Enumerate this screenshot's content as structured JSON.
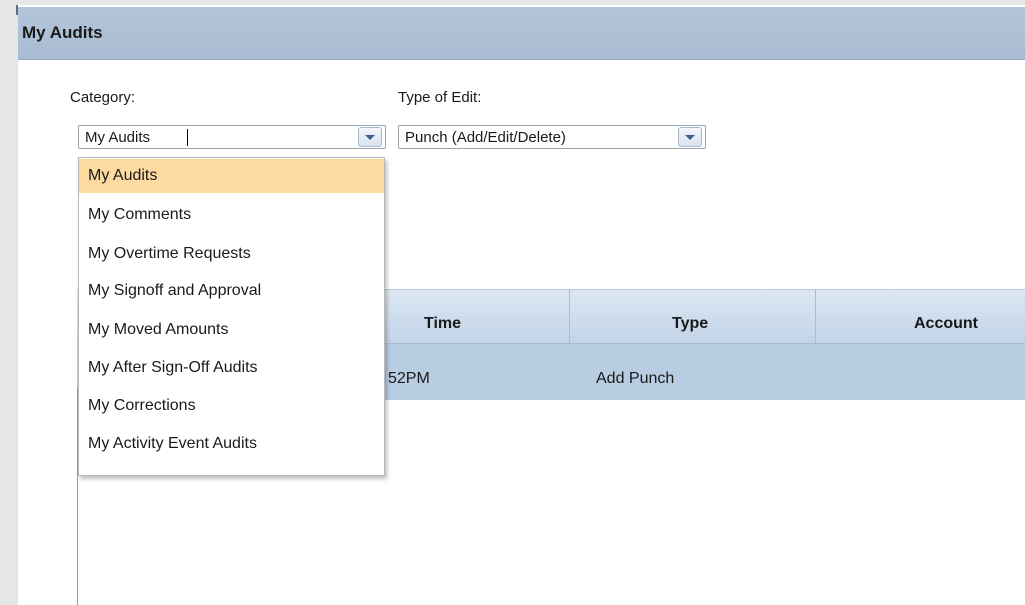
{
  "panel": {
    "title": "My Audits"
  },
  "filters": {
    "category_label": "Category:",
    "category_value": "My Audits",
    "type_label": "Type of Edit:",
    "type_value": "Punch (Add/Edit/Delete)"
  },
  "dropdown": {
    "items": [
      {
        "label": "My Audits",
        "selected": true
      },
      {
        "label": "My Comments"
      },
      {
        "label": "My Overtime Requests"
      },
      {
        "label": "My Signoff and Approval"
      },
      {
        "label": "My Moved Amounts"
      },
      {
        "label": "My After Sign-Off Audits"
      },
      {
        "label": "My Corrections"
      },
      {
        "label": "My Activity Event Audits"
      }
    ]
  },
  "grid": {
    "columns": [
      "Time",
      "Type",
      "Account"
    ],
    "rows": [
      {
        "time": "52PM",
        "type": "Add Punch",
        "account": ""
      }
    ]
  },
  "colors": {
    "header_bg": "#b3c5d9",
    "selected_item": "#fddba0",
    "row_highlight": "#b8cce2"
  }
}
